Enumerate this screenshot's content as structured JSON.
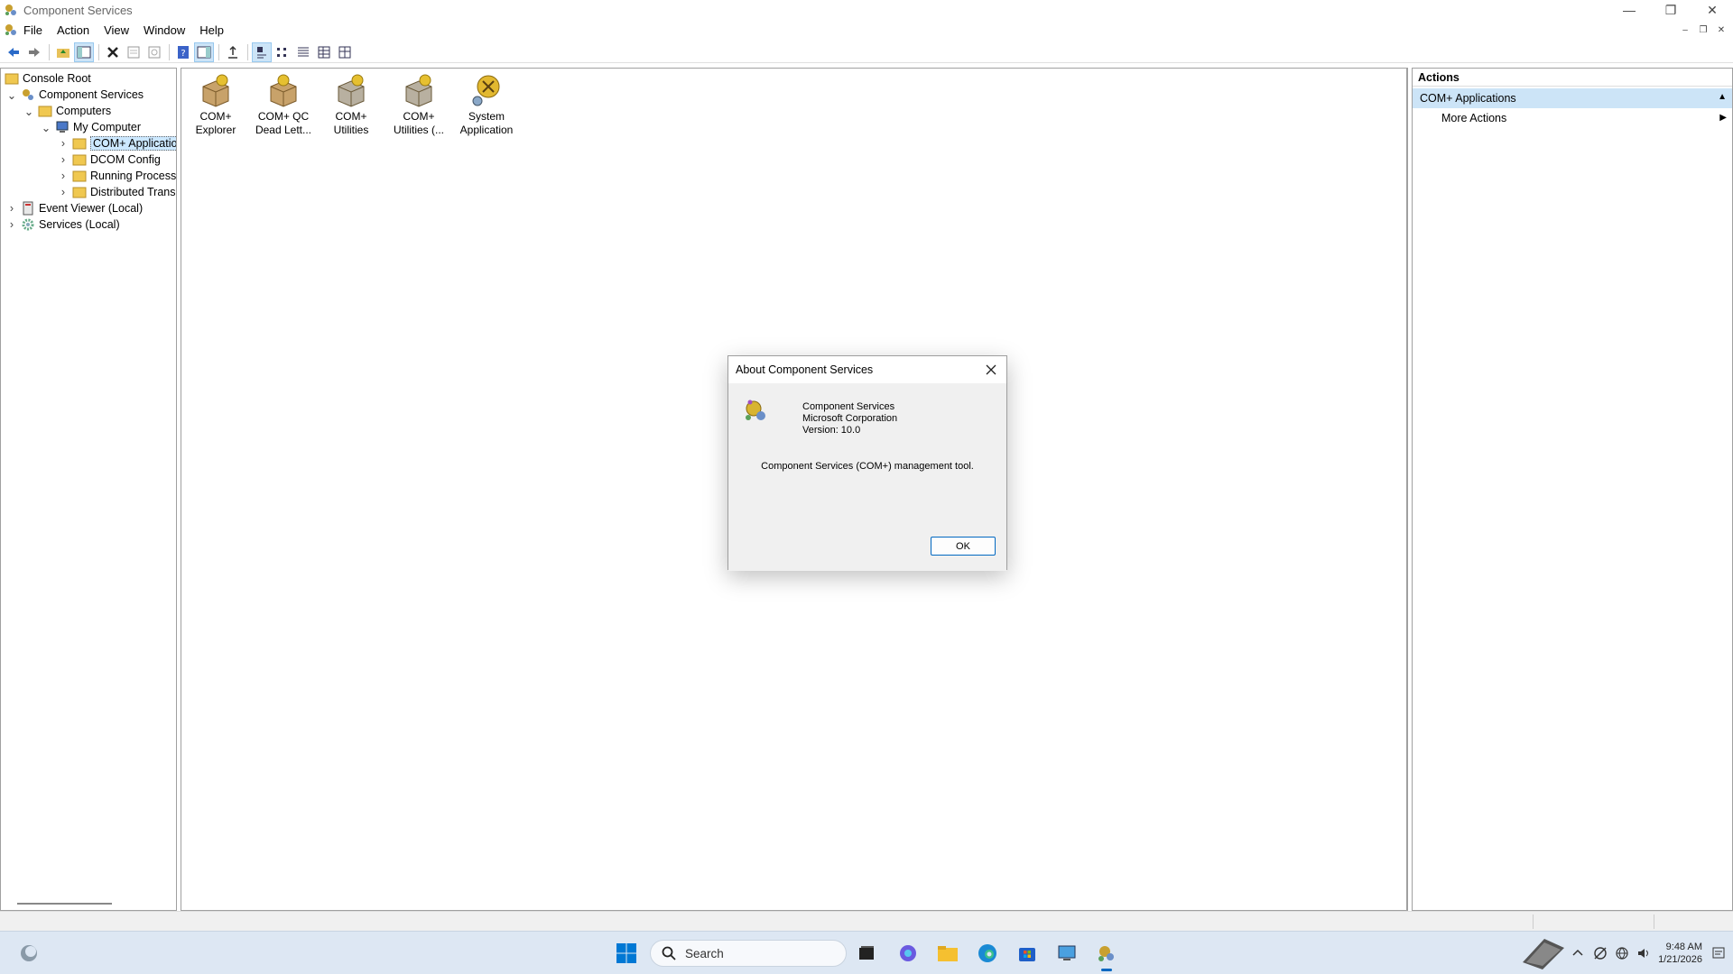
{
  "window": {
    "title": "Component Services",
    "minimize": "—",
    "restore": "❐",
    "close": "✕"
  },
  "menu": {
    "items": [
      "File",
      "Action",
      "View",
      "Window",
      "Help"
    ]
  },
  "mdi": {
    "minimize": "–",
    "restore": "❐",
    "close": "✕"
  },
  "tree": {
    "console_root": "Console Root",
    "component_services": "Component Services",
    "computers": "Computers",
    "my_computer": "My Computer",
    "com_apps": "COM+ Applications",
    "dcom_config": "DCOM Config",
    "running_processes": "Running Processes",
    "distributed_trans": "Distributed Transaction Coordinator",
    "event_viewer": "Event Viewer (Local)",
    "services_local": "Services (Local)"
  },
  "center": {
    "items": [
      {
        "line1": "COM+",
        "line2": "Explorer"
      },
      {
        "line1": "COM+ QC",
        "line2": "Dead Lett..."
      },
      {
        "line1": "COM+",
        "line2": "Utilities"
      },
      {
        "line1": "COM+",
        "line2": "Utilities (..."
      },
      {
        "line1": "System",
        "line2": "Application"
      }
    ]
  },
  "actions": {
    "header": "Actions",
    "section": "COM+ Applications",
    "more_actions": "More Actions"
  },
  "dialog": {
    "title": "About Component Services",
    "product": "Component Services",
    "company": "Microsoft Corporation",
    "version": "Version: 10.0",
    "description": "Component Services (COM+) management tool.",
    "ok": "OK"
  },
  "taskbar": {
    "search_placeholder": "Search",
    "time": "9:48 AM",
    "date": "1/21/2026"
  },
  "colors": {
    "accent": "#0067c0",
    "selection": "#cce4f7",
    "taskbar_bg": "#dde7f3"
  }
}
